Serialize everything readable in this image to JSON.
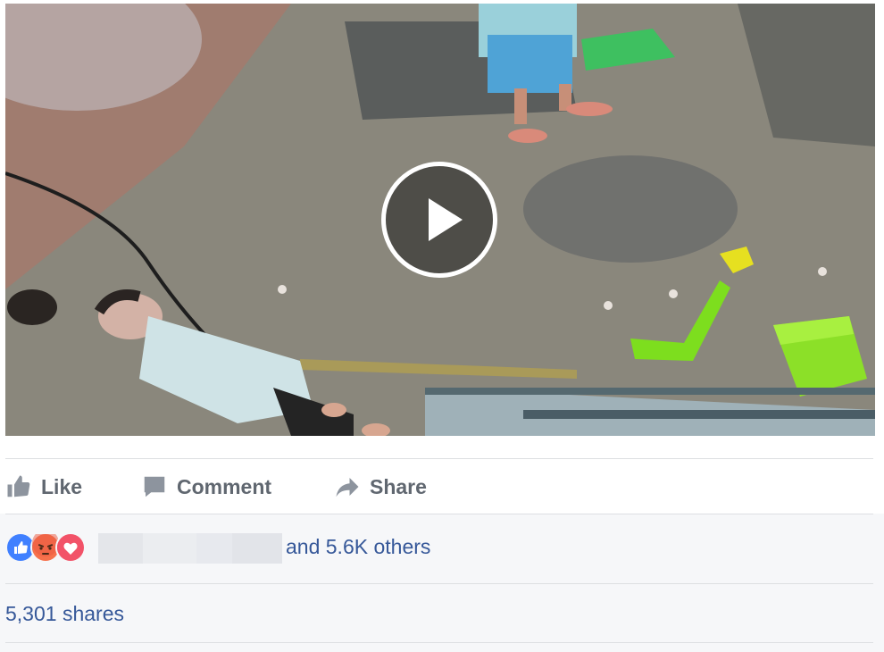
{
  "video": {
    "play_icon": "play-icon"
  },
  "actions": {
    "like": {
      "label": "Like",
      "icon": "thumbs-up-icon"
    },
    "comment": {
      "label": "Comment",
      "icon": "comment-bubble-icon"
    },
    "share": {
      "label": "Share",
      "icon": "share-arrow-icon"
    }
  },
  "reactions": {
    "icons": [
      "like-reaction-icon",
      "angry-reaction-icon",
      "love-reaction-icon"
    ],
    "others_text": "and 5.6K others"
  },
  "shares": {
    "text": "5,301 shares"
  },
  "colors": {
    "link": "#365899",
    "action_gray": "#606770",
    "like_blue": "#4080ff",
    "angry_orange": "#f7714c",
    "love_red": "#f25268"
  }
}
